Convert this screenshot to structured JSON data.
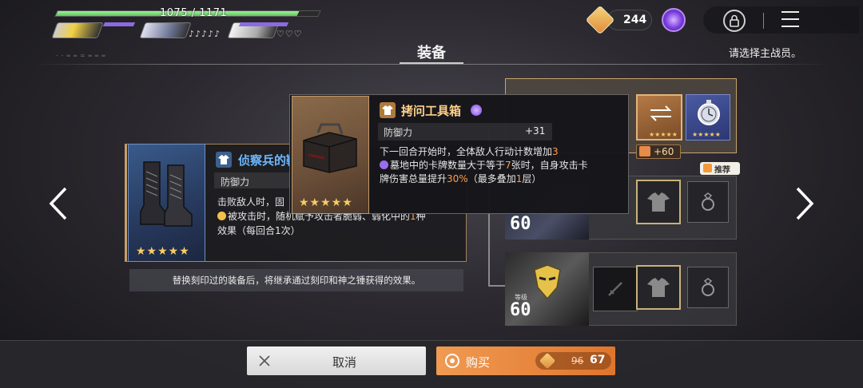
{
  "hud": {
    "hp_text": "1075 / 1171",
    "hp_fraction": 0.92,
    "notes_2": "♪♪♪♪♪",
    "notes_3": "♡♡♡",
    "gold": "244"
  },
  "page": {
    "title": "装备",
    "hint": "请选择主战员。",
    "code": "- - ═ ═ = ═ ═ ═"
  },
  "left_item": {
    "name": "侦察兵的靴",
    "stat_label": "防御力",
    "desc_1": "击败敌人时，固",
    "desc_2": "被攻击时，随机赋予攻击者脆弱、弱化中的",
    "desc_2_hl": "1",
    "desc_2_tail": "种",
    "desc_3": "效果（每回合1次）",
    "stars": "★★★★★",
    "note": "替换刻印过的装备后，将继承通过刻印和神之锤获得的效果。"
  },
  "tooltip": {
    "name": "拷问工具箱",
    "stat_label": "防御力",
    "stat_value": "+31",
    "stars": "★★★★★",
    "line1": "下一回合开始时，全体敌人行动计数增加",
    "line1_hl": "3",
    "line2a": "墓地中的卡牌数量大于等于",
    "line2_hl": "7",
    "line2b": "张时，自身攻击卡",
    "line3a": "牌伤害总量提升",
    "line3_hl": "30%",
    "line3b": "（最多叠加",
    "line3_hl2": "1",
    "line3c": "层）"
  },
  "party": {
    "plus_value": "+60",
    "recommend": "推荐",
    "char2_level": "60",
    "char3_level_label": "等级",
    "char3_level": "60",
    "slot_stars": "★★★★★"
  },
  "actions": {
    "cancel": "取消",
    "buy": "购买",
    "price_old": "96",
    "price_new": "67"
  },
  "colors": {
    "accent_orange": "#e0752c",
    "item_name_blue": "#6fb8ff",
    "item_name_gold": "#ffd08a",
    "highlight": "#ff9d4a",
    "hp_green": "#5fc45a"
  }
}
